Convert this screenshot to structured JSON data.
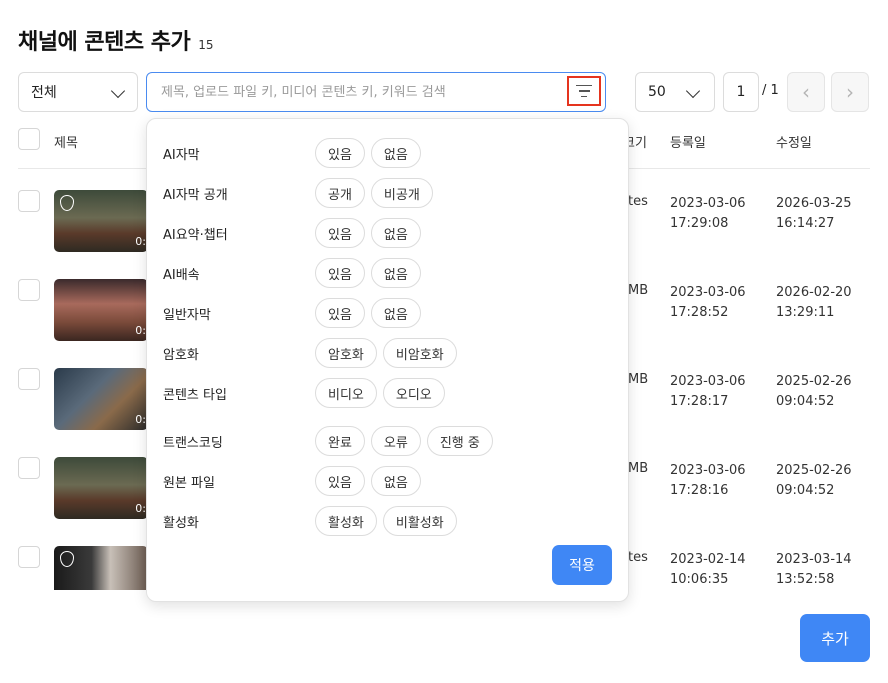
{
  "title": "채널에 콘텐츠 추가",
  "title_count": "15",
  "filter_select": {
    "value": "전체"
  },
  "search": {
    "placeholder": "제목, 업로드 파일 키, 미디어 콘텐츠 키, 키워드 검색"
  },
  "pagination": {
    "per_page": "50",
    "page": "1",
    "total": "/ 1",
    "prev_icon": "‹",
    "next_icon": "›"
  },
  "columns": {
    "title": "제목",
    "size_partial": "크기",
    "registered": "등록일",
    "modified": "수정일"
  },
  "rows": [
    {
      "duration": "0:",
      "size_partial": "tes",
      "registered_date": "2023-03-06",
      "registered_time": "17:29:08",
      "modified_date": "2026-03-25",
      "modified_time": "16:14:27"
    },
    {
      "duration": "0:",
      "size_partial": "MB",
      "registered_date": "2023-03-06",
      "registered_time": "17:28:52",
      "modified_date": "2026-02-20",
      "modified_time": "13:29:11"
    },
    {
      "duration": "0:",
      "size_partial": "MB",
      "registered_date": "2023-03-06",
      "registered_time": "17:28:17",
      "modified_date": "2025-02-26",
      "modified_time": "09:04:52"
    },
    {
      "duration": "0:",
      "size_partial": "MB",
      "registered_date": "2023-03-06",
      "registered_time": "17:28:16",
      "modified_date": "2025-02-26",
      "modified_time": "09:04:52"
    },
    {
      "duration": "",
      "size_partial": "tes",
      "registered_date": "2023-02-14",
      "registered_time": "10:06:35",
      "modified_date": "2023-03-14",
      "modified_time": "13:52:58"
    }
  ],
  "filters": [
    {
      "label": "AI자막",
      "options": [
        "있음",
        "없음"
      ]
    },
    {
      "label": "AI자막 공개",
      "options": [
        "공개",
        "비공개"
      ]
    },
    {
      "label": "AI요약·챕터",
      "options": [
        "있음",
        "없음"
      ]
    },
    {
      "label": "AI배속",
      "options": [
        "있음",
        "없음"
      ]
    },
    {
      "label": "일반자막",
      "options": [
        "있음",
        "없음"
      ]
    },
    {
      "label": "암호화",
      "options": [
        "암호화",
        "비암호화"
      ]
    },
    {
      "label": "콘텐츠 타입",
      "options": [
        "비디오",
        "오디오"
      ]
    },
    {
      "label": "트랜스코딩",
      "options": [
        "완료",
        "오류",
        "진행 중"
      ]
    },
    {
      "label": "원본 파일",
      "options": [
        "있음",
        "없음"
      ]
    },
    {
      "label": "활성화",
      "options": [
        "활성화",
        "비활성화"
      ]
    }
  ],
  "apply_label": "적용",
  "add_label": "추가",
  "colors": {
    "accent": "#3f87f5",
    "highlight": "#e5341e"
  }
}
